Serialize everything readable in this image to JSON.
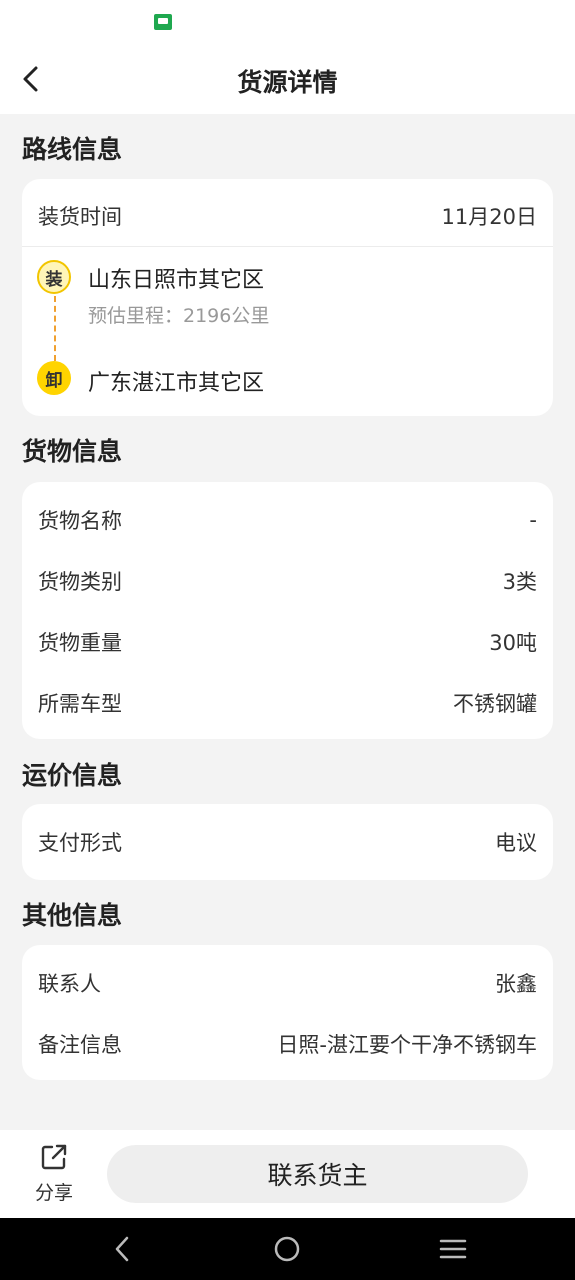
{
  "nav": {
    "title": "货源详情"
  },
  "route": {
    "section_title": "路线信息",
    "load_time_label": "装货时间",
    "load_time_value": "11月20日",
    "load_badge": "装",
    "load_place": "山东日照市其它区",
    "distance": "预估里程：2196公里",
    "unload_badge": "卸",
    "unload_place": "广东湛江市其它区"
  },
  "cargo": {
    "section_title": "货物信息",
    "rows": [
      {
        "label": "货物名称",
        "value": "-"
      },
      {
        "label": "货物类别",
        "value": "3类"
      },
      {
        "label": "货物重量",
        "value": "30吨"
      },
      {
        "label": "所需车型",
        "value": "不锈钢罐"
      }
    ]
  },
  "price": {
    "section_title": "运价信息",
    "rows": [
      {
        "label": "支付形式",
        "value": "电议"
      }
    ]
  },
  "other": {
    "section_title": "其他信息",
    "rows": [
      {
        "label": "联系人",
        "value": "张鑫"
      },
      {
        "label": "备注信息",
        "value": "日照-湛江要个干净不锈钢车"
      }
    ]
  },
  "bottom": {
    "share_label": "分享",
    "contact_label": "联系货主"
  },
  "icons": {
    "back": "back-arrow-icon",
    "share": "share-icon",
    "app": "app-notification-icon"
  },
  "colors": {
    "accent": "#ffd400",
    "dash": "#f0a030"
  }
}
